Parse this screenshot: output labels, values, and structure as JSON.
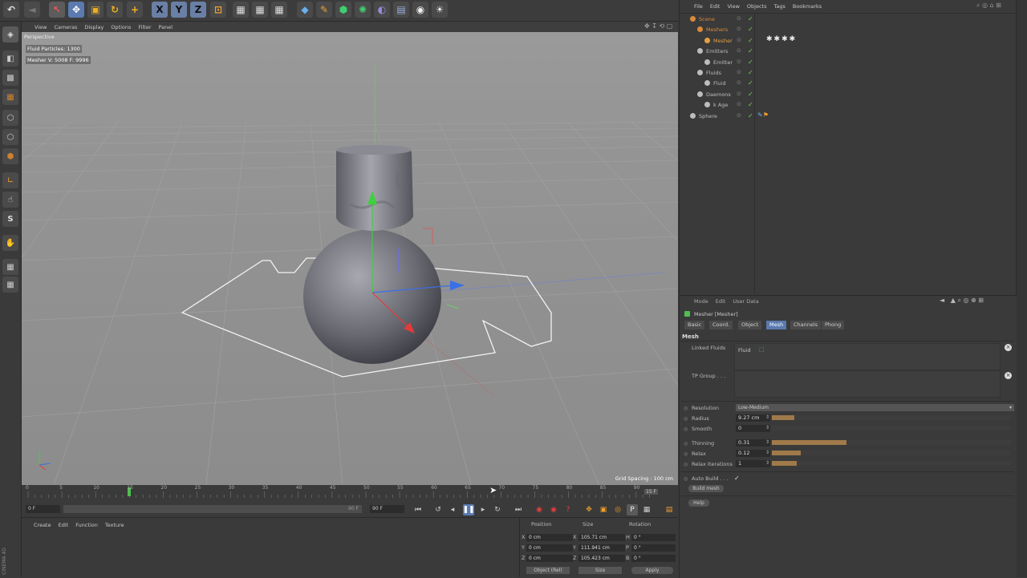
{
  "app": {
    "vertical_brand": "CINEMA 4D"
  },
  "top_toolbar": {
    "icons": [
      "undo-icon",
      "move-tool-icon",
      "move-icon",
      "scale-icon",
      "rotate-icon",
      "add-icon",
      "x-axis-icon",
      "y-axis-icon",
      "z-axis-icon",
      "coordinate-system-icon",
      "render-view-icon",
      "render-picture-viewer-icon",
      "render-settings-icon",
      "cube-icon",
      "pen-icon",
      "subdivision-icon",
      "array-icon",
      "deformer-icon",
      "floor-icon",
      "camera-icon",
      "light-icon"
    ],
    "axis_labels": [
      "X",
      "Y",
      "Z"
    ]
  },
  "viewport": {
    "menu": [
      "View",
      "Cameras",
      "Display",
      "Options",
      "Filter",
      "Panel"
    ],
    "name": "Perspective",
    "hud_line1": "Fluid Particles: 1300",
    "hud_line2": "Mesher V: 5008 F: 9996",
    "grid_spacing": "Grid Spacing : 100 cm"
  },
  "timeline": {
    "ticks": [
      "0",
      "5",
      "10",
      "15",
      "20",
      "25",
      "30",
      "35",
      "40",
      "45",
      "50",
      "55",
      "60",
      "65",
      "70",
      "75",
      "80",
      "85",
      "90"
    ],
    "end_label": "15 F",
    "start_field": "0 F",
    "range_end": "90 F",
    "end_field": "90 F",
    "playhead_frame": 15
  },
  "material_manager": {
    "menu": [
      "Create",
      "Edit",
      "Function",
      "Texture"
    ]
  },
  "coordinates": {
    "headers": [
      "Position",
      "Size",
      "Rotation"
    ],
    "rows": [
      {
        "axis": "X",
        "pos": "0 cm",
        "size_axis": "X",
        "size": "105.71 cm",
        "rot_axis": "H",
        "rot": "0 °"
      },
      {
        "axis": "Y",
        "pos": "0 cm",
        "size_axis": "Y",
        "size": "111.941 cm",
        "rot_axis": "P",
        "rot": "0 °"
      },
      {
        "axis": "Z",
        "pos": "0 cm",
        "size_axis": "Z",
        "size": "105.423 cm",
        "rot_axis": "B",
        "rot": "0 °"
      }
    ],
    "mode_select": "Object (Rel)",
    "size_select": "Size",
    "apply": "Apply"
  },
  "object_manager": {
    "menu": [
      "File",
      "Edit",
      "View",
      "Objects",
      "Tags",
      "Bookmarks"
    ],
    "rows": [
      {
        "name": "Scene",
        "indent": 0,
        "color": "#d98a3a"
      },
      {
        "name": "Meshers",
        "indent": 1,
        "color": "#d98a3a"
      },
      {
        "name": "Mesher",
        "indent": 2,
        "color": "#e6a040"
      },
      {
        "name": "Emitters",
        "indent": 1,
        "color": "#bdbdbd"
      },
      {
        "name": "Emitter",
        "indent": 2,
        "color": "#bdbdbd"
      },
      {
        "name": "Fluids",
        "indent": 1,
        "color": "#bdbdbd"
      },
      {
        "name": "Fluid",
        "indent": 2,
        "color": "#bdbdbd"
      },
      {
        "name": "Daemons",
        "indent": 1,
        "color": "#bdbdbd"
      },
      {
        "name": "k Age",
        "indent": 2,
        "color": "#bdbdbd"
      },
      {
        "name": "Sphere",
        "indent": 0,
        "color": "#bdbdbd"
      }
    ]
  },
  "attributes": {
    "menu": [
      "Mode",
      "Edit",
      "User Data"
    ],
    "title": "Mesher [Mesher]",
    "tabs": [
      "Basic",
      "Coord.",
      "Object",
      "Mesh",
      "Channels",
      "Phong"
    ],
    "active_tab": "Mesh",
    "section": "Mesh",
    "linked_fluids_label": "Linked Fluids",
    "linked_fluids_value": "Fluid",
    "tp_group_label": "TP Group . . .",
    "resolution_label": "Resolution",
    "resolution_value": "Low-Medium",
    "params": [
      {
        "label": "Radius",
        "value": "9.27 cm",
        "fill": 0.22
      },
      {
        "label": "Smooth",
        "value": "0",
        "fill": 0.0
      },
      {
        "label": "Thinning",
        "value": "0.31",
        "fill": 0.74
      },
      {
        "label": "Relax",
        "value": "0.12",
        "fill": 0.29
      },
      {
        "label": "Relax Iterations",
        "value": "1",
        "fill": 0.25
      }
    ],
    "auto_build_label": "Auto Build . . .",
    "auto_build_check": "✓",
    "build_mesh": "Build mesh",
    "help": "Help"
  },
  "colors": {
    "accent_blue": "#5a8fd8",
    "axis_x": "#e23b3b",
    "axis_y": "#3fcf3f",
    "axis_z": "#3a6fe8",
    "viewport_bg": "#8f8f8f"
  }
}
